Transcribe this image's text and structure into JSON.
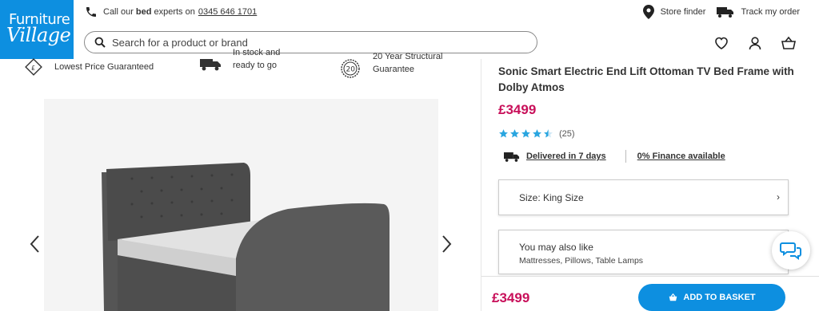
{
  "brand": {
    "logo_line1": "Furniture",
    "logo_line2": "Village",
    "color": "#0d8fe0"
  },
  "callbar": {
    "prefix": "Call our",
    "bold": "bed",
    "suffix": "experts on",
    "phone": "0345 646 1701"
  },
  "topbar": {
    "store_finder": "Store finder",
    "track_order": "Track my order"
  },
  "search": {
    "placeholder": "Search for a product or brand"
  },
  "header_icons": [
    "heart-icon",
    "user-icon",
    "basket-icon"
  ],
  "features": [
    {
      "icon": "price-tag-icon",
      "line1": "Lowest Price Guaranteed",
      "line2": ""
    },
    {
      "icon": "delivery-truck-icon",
      "line1": "In stock and",
      "line2": "ready to go"
    },
    {
      "icon": "guarantee-badge-icon",
      "line1": "20 Year Structural",
      "line2": "Guarantee",
      "badge": "20"
    }
  ],
  "product": {
    "title": "Sonic Smart Electric End Lift Ottoman TV Bed Frame with Dolby Atmos",
    "price": "£3499",
    "rating": 4.5,
    "review_count": "(25)",
    "delivery": "Delivered in 7 days",
    "finance": "0% Finance available",
    "size_label": "Size: King Size",
    "also_like_title": "You may also like",
    "also_like_items": "Mattresses, Pillows, Table Lamps"
  },
  "sticky": {
    "price": "£3499",
    "add_to_basket": "ADD TO BASKET"
  },
  "colors": {
    "price": "#c8105a",
    "accent": "#0d8fe0",
    "star": "#2aa6e0"
  }
}
